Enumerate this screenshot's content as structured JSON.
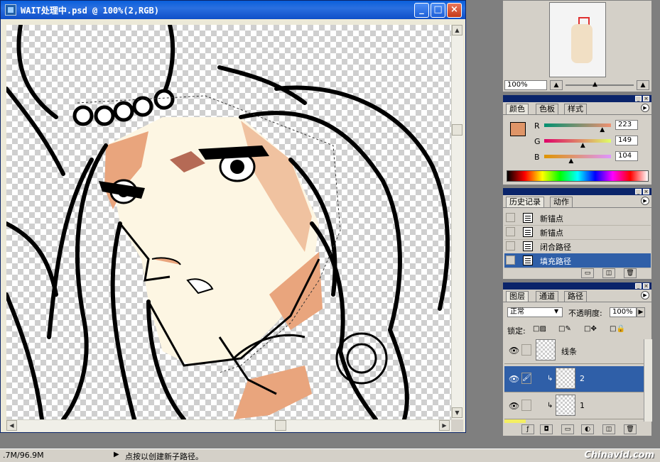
{
  "document": {
    "title": "WAIT处理中.psd @ 100%(2,RGB)",
    "minimize": "_",
    "maximize": "□",
    "close": "×"
  },
  "status": {
    "memory": ".7M/96.9M",
    "arrow": "▶",
    "message": "点按以创建新子路径。",
    "watermark": "Chinavid.com"
  },
  "navigator": {
    "zoom": "100%"
  },
  "color_panel": {
    "tabs": [
      "颜色",
      "色板",
      "样式"
    ],
    "swatch": "#df9568",
    "channels": [
      {
        "label": "R",
        "value": "223",
        "level": 0.875
      },
      {
        "label": "G",
        "value": "149",
        "level": 0.584
      },
      {
        "label": "B",
        "value": "104",
        "level": 0.408
      }
    ]
  },
  "history_panel": {
    "tabs": [
      "历史记录",
      "动作"
    ],
    "items": [
      {
        "label": "新锚点",
        "selected": false
      },
      {
        "label": "新锚点",
        "selected": false
      },
      {
        "label": "闭合路径",
        "selected": false
      },
      {
        "label": "填充路径",
        "selected": true
      }
    ]
  },
  "layers_panel": {
    "tabs": [
      "图层",
      "通道",
      "路径"
    ],
    "blend_mode": "正常",
    "opacity_label": "不透明度:",
    "opacity": "100%",
    "lock_label": "锁定:",
    "layers": [
      {
        "name": "线条",
        "visible": true,
        "link": "",
        "selected": false
      },
      {
        "name": "2",
        "visible": true,
        "link": "🖌",
        "selected": true
      },
      {
        "name": "1",
        "visible": true,
        "link": "",
        "selected": false
      }
    ]
  },
  "colors": {
    "skin": "#fdf6e3",
    "shadow": "#e9a57d",
    "selection": "#2f5fa8",
    "title_bar": "#0a5fdc"
  }
}
